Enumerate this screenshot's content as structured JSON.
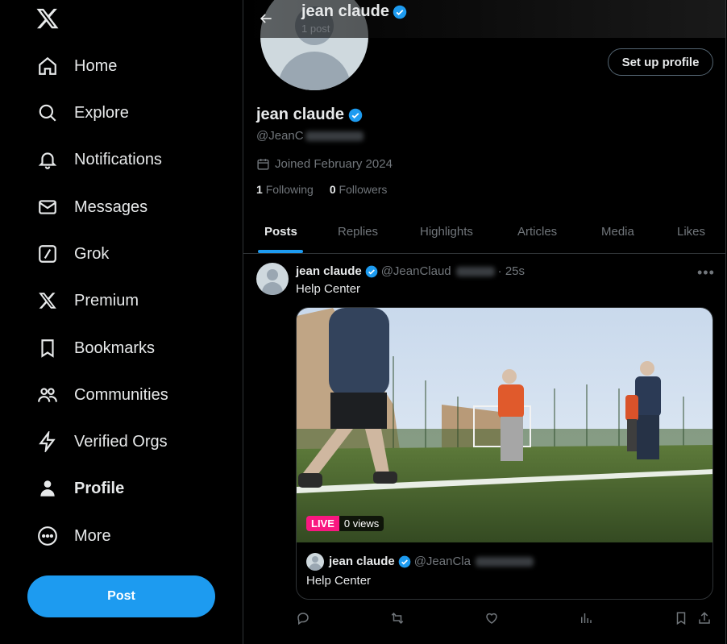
{
  "sidebar": {
    "items": [
      {
        "label": "Home",
        "icon": "home-icon"
      },
      {
        "label": "Explore",
        "icon": "search-icon"
      },
      {
        "label": "Notifications",
        "icon": "bell-icon"
      },
      {
        "label": "Messages",
        "icon": "envelope-icon"
      },
      {
        "label": "Grok",
        "icon": "grok-icon"
      },
      {
        "label": "Premium",
        "icon": "x-logo-icon"
      },
      {
        "label": "Bookmarks",
        "icon": "bookmark-icon"
      },
      {
        "label": "Communities",
        "icon": "people-icon"
      },
      {
        "label": "Verified Orgs",
        "icon": "lightning-icon"
      },
      {
        "label": "Profile",
        "icon": "person-icon"
      },
      {
        "label": "More",
        "icon": "more-circle-icon"
      }
    ],
    "post_label": "Post"
  },
  "header": {
    "name": "jean claude",
    "post_count": "1 post"
  },
  "profile": {
    "name": "jean claude",
    "handle": "@JeanC",
    "joined": "Joined February 2024",
    "following_count": "1",
    "following_label": "Following",
    "followers_count": "0",
    "followers_label": "Followers",
    "setup_label": "Set up profile"
  },
  "tabs": [
    "Posts",
    "Replies",
    "Highlights",
    "Articles",
    "Media",
    "Likes"
  ],
  "tweet": {
    "name": "jean claude",
    "handle": "@JeanClaud",
    "time": "· 25s",
    "text": "Help Center",
    "live_label": "LIVE",
    "views": "0 views",
    "quote": {
      "name": "jean claude",
      "handle": "@JeanCla",
      "text": "Help Center"
    }
  },
  "colors": {
    "accent": "#1d9bf0",
    "live": "#f91880",
    "background": "#000000",
    "muted": "#71767b"
  }
}
